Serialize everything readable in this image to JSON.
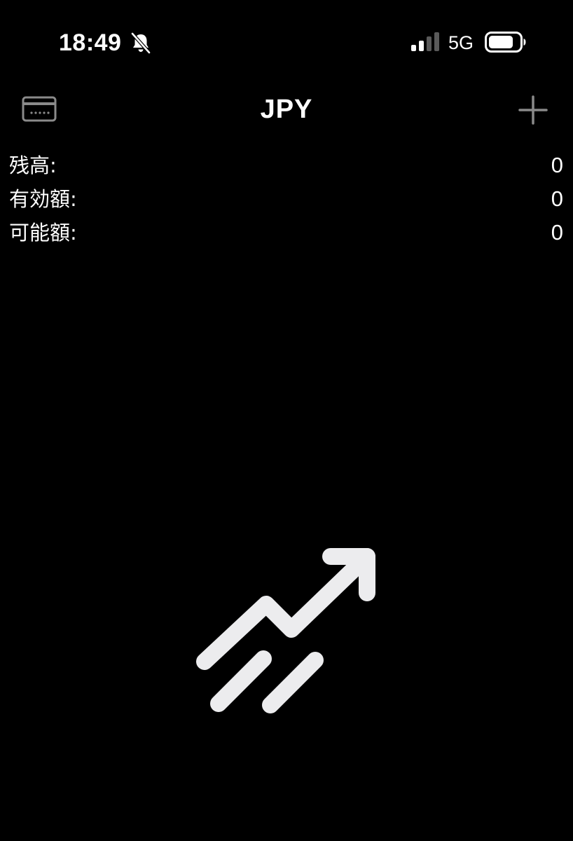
{
  "status_bar": {
    "time": "18:49",
    "network": "5G",
    "icons": [
      "bell-muted-icon",
      "cellular-signal-icon",
      "battery-icon"
    ]
  },
  "nav": {
    "title": "JPY",
    "left_icon": "credit-card-icon",
    "right_icon": "plus-icon"
  },
  "summary": [
    {
      "label": "残高:",
      "value": "0"
    },
    {
      "label": "有効額:",
      "value": "0"
    },
    {
      "label": "可能額:",
      "value": "0"
    }
  ],
  "empty_state": {
    "icon": "trending-up-icon"
  },
  "colors": {
    "background": "#000000",
    "text": "#ffffff",
    "icon_gray": "#8a8a8a",
    "graphic": "#ececee"
  }
}
